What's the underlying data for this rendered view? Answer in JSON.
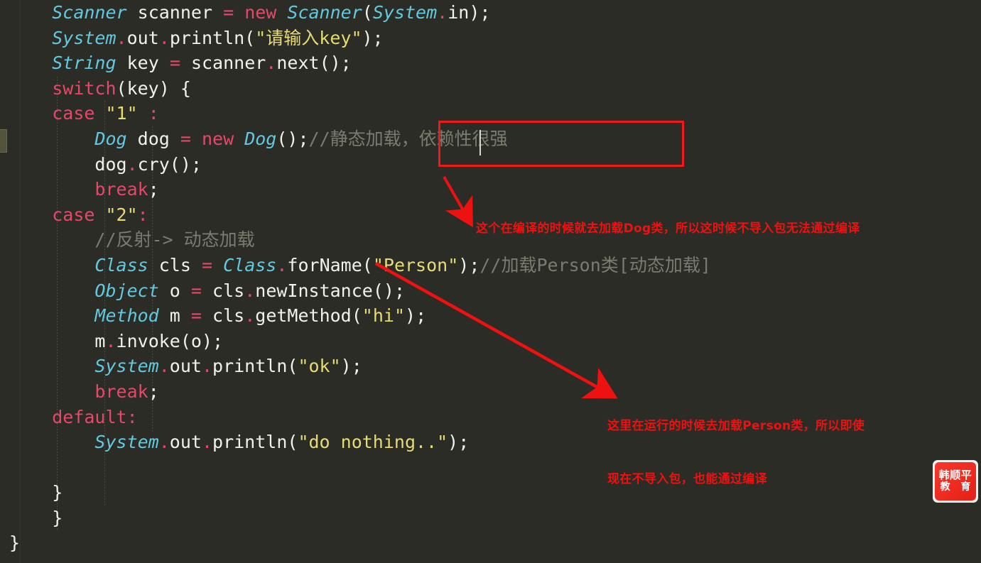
{
  "editor": {
    "background_color": "#2b2c25",
    "lines": [
      {
        "indent": 0,
        "tokens": [
          {
            "t": "Scanner",
            "c": "cls"
          },
          {
            "t": " ",
            "c": "plain"
          },
          {
            "t": "scanner",
            "c": "plain"
          },
          {
            "t": " ",
            "c": "plain"
          },
          {
            "t": "=",
            "c": "kw"
          },
          {
            "t": " ",
            "c": "plain"
          },
          {
            "t": "new",
            "c": "kw"
          },
          {
            "t": " ",
            "c": "plain"
          },
          {
            "t": "Scanner",
            "c": "cls"
          },
          {
            "t": "(",
            "c": "punc"
          },
          {
            "t": "System",
            "c": "cls"
          },
          {
            "t": ".",
            "c": "dot"
          },
          {
            "t": "in",
            "c": "plain"
          },
          {
            "t": ");",
            "c": "punc"
          }
        ]
      },
      {
        "indent": 0,
        "tokens": [
          {
            "t": "System",
            "c": "cls"
          },
          {
            "t": ".",
            "c": "dot"
          },
          {
            "t": "out",
            "c": "plain"
          },
          {
            "t": ".",
            "c": "dot"
          },
          {
            "t": "println",
            "c": "plain"
          },
          {
            "t": "(",
            "c": "punc"
          },
          {
            "t": "\"请输入key\"",
            "c": "str"
          },
          {
            "t": ");",
            "c": "punc"
          }
        ]
      },
      {
        "indent": 0,
        "tokens": [
          {
            "t": "String",
            "c": "cls"
          },
          {
            "t": " ",
            "c": "plain"
          },
          {
            "t": "key",
            "c": "plain"
          },
          {
            "t": " ",
            "c": "plain"
          },
          {
            "t": "=",
            "c": "kw"
          },
          {
            "t": " ",
            "c": "plain"
          },
          {
            "t": "scanner",
            "c": "plain"
          },
          {
            "t": ".",
            "c": "dot"
          },
          {
            "t": "next",
            "c": "plain"
          },
          {
            "t": "();",
            "c": "punc"
          }
        ]
      },
      {
        "indent": 0,
        "tokens": [
          {
            "t": "switch",
            "c": "kw"
          },
          {
            "t": "(key) {",
            "c": "punc"
          }
        ]
      },
      {
        "indent": 1,
        "tokens": [
          {
            "t": "case",
            "c": "kw"
          },
          {
            "t": " ",
            "c": "plain"
          },
          {
            "t": "\"1\"",
            "c": "str"
          },
          {
            "t": " ",
            "c": "plain"
          },
          {
            "t": ":",
            "c": "kw"
          }
        ]
      },
      {
        "indent": 2,
        "tokens": [
          {
            "t": "Dog",
            "c": "cls"
          },
          {
            "t": " ",
            "c": "plain"
          },
          {
            "t": "dog",
            "c": "plain"
          },
          {
            "t": " ",
            "c": "plain"
          },
          {
            "t": "=",
            "c": "kw"
          },
          {
            "t": " ",
            "c": "plain"
          },
          {
            "t": "new",
            "c": "kw"
          },
          {
            "t": " ",
            "c": "plain"
          },
          {
            "t": "Dog",
            "c": "cls"
          },
          {
            "t": "();",
            "c": "punc"
          },
          {
            "t": "//静态加载，依赖性很强",
            "c": "cmt"
          }
        ]
      },
      {
        "indent": 2,
        "tokens": [
          {
            "t": "dog",
            "c": "plain"
          },
          {
            "t": ".",
            "c": "dot"
          },
          {
            "t": "cry",
            "c": "plain"
          },
          {
            "t": "();",
            "c": "punc"
          }
        ]
      },
      {
        "indent": 2,
        "tokens": [
          {
            "t": "break",
            "c": "kw"
          },
          {
            "t": ";",
            "c": "punc"
          }
        ]
      },
      {
        "indent": 1,
        "tokens": [
          {
            "t": "case",
            "c": "kw"
          },
          {
            "t": " ",
            "c": "plain"
          },
          {
            "t": "\"2\"",
            "c": "str"
          },
          {
            "t": ":",
            "c": "kw"
          }
        ]
      },
      {
        "indent": 2,
        "tokens": [
          {
            "t": "//反射-> 动态加载",
            "c": "cmt"
          }
        ]
      },
      {
        "indent": 2,
        "tokens": [
          {
            "t": "Class",
            "c": "cls"
          },
          {
            "t": " ",
            "c": "plain"
          },
          {
            "t": "cls",
            "c": "plain"
          },
          {
            "t": " ",
            "c": "plain"
          },
          {
            "t": "=",
            "c": "kw"
          },
          {
            "t": " ",
            "c": "plain"
          },
          {
            "t": "Class",
            "c": "cls"
          },
          {
            "t": ".",
            "c": "dot"
          },
          {
            "t": "forName",
            "c": "plain"
          },
          {
            "t": "(",
            "c": "punc"
          },
          {
            "t": "\"Person\"",
            "c": "str"
          },
          {
            "t": ");",
            "c": "punc"
          },
          {
            "t": "//加载Person类[动态加载]",
            "c": "cmt"
          }
        ]
      },
      {
        "indent": 2,
        "tokens": [
          {
            "t": "Object",
            "c": "cls"
          },
          {
            "t": " ",
            "c": "plain"
          },
          {
            "t": "o",
            "c": "plain"
          },
          {
            "t": " ",
            "c": "plain"
          },
          {
            "t": "=",
            "c": "kw"
          },
          {
            "t": " ",
            "c": "plain"
          },
          {
            "t": "cls",
            "c": "plain"
          },
          {
            "t": ".",
            "c": "dot"
          },
          {
            "t": "newInstance",
            "c": "plain"
          },
          {
            "t": "();",
            "c": "punc"
          }
        ]
      },
      {
        "indent": 2,
        "tokens": [
          {
            "t": "Method",
            "c": "cls"
          },
          {
            "t": " ",
            "c": "plain"
          },
          {
            "t": "m",
            "c": "plain"
          },
          {
            "t": " ",
            "c": "plain"
          },
          {
            "t": "=",
            "c": "kw"
          },
          {
            "t": " ",
            "c": "plain"
          },
          {
            "t": "cls",
            "c": "plain"
          },
          {
            "t": ".",
            "c": "dot"
          },
          {
            "t": "getMethod",
            "c": "plain"
          },
          {
            "t": "(",
            "c": "punc"
          },
          {
            "t": "\"hi\"",
            "c": "str"
          },
          {
            "t": ");",
            "c": "punc"
          }
        ]
      },
      {
        "indent": 2,
        "tokens": [
          {
            "t": "m",
            "c": "plain"
          },
          {
            "t": ".",
            "c": "dot"
          },
          {
            "t": "invoke",
            "c": "plain"
          },
          {
            "t": "(o);",
            "c": "punc"
          }
        ]
      },
      {
        "indent": 2,
        "tokens": [
          {
            "t": "System",
            "c": "cls"
          },
          {
            "t": ".",
            "c": "dot"
          },
          {
            "t": "out",
            "c": "plain"
          },
          {
            "t": ".",
            "c": "dot"
          },
          {
            "t": "println",
            "c": "plain"
          },
          {
            "t": "(",
            "c": "punc"
          },
          {
            "t": "\"ok\"",
            "c": "str"
          },
          {
            "t": ");",
            "c": "punc"
          }
        ]
      },
      {
        "indent": 2,
        "tokens": [
          {
            "t": "break",
            "c": "kw"
          },
          {
            "t": ";",
            "c": "punc"
          }
        ]
      },
      {
        "indent": 1,
        "tokens": [
          {
            "t": "default",
            "c": "kw"
          },
          {
            "t": ":",
            "c": "kw"
          }
        ]
      },
      {
        "indent": 2,
        "tokens": [
          {
            "t": "System",
            "c": "cls"
          },
          {
            "t": ".",
            "c": "dot"
          },
          {
            "t": "out",
            "c": "plain"
          },
          {
            "t": ".",
            "c": "dot"
          },
          {
            "t": "println",
            "c": "plain"
          },
          {
            "t": "(",
            "c": "punc"
          },
          {
            "t": "\"do nothing..\"",
            "c": "str"
          },
          {
            "t": ");",
            "c": "punc"
          }
        ]
      },
      {
        "indent": 0,
        "tokens": []
      },
      {
        "indent": 1,
        "tokens": [
          {
            "t": "}",
            "c": "punc"
          }
        ]
      },
      {
        "indent": 0,
        "tokens": [
          {
            "t": "}",
            "c": "punc"
          }
        ]
      },
      {
        "indent": -1,
        "tokens": [
          {
            "t": "}",
            "c": "punc"
          }
        ]
      }
    ]
  },
  "annotations": {
    "highlight_box": {
      "color": "#f01818",
      "surrounds_text": "//静态加载，依赖性很强"
    },
    "note_1": {
      "text": "这个在编译的时候就去加载Dog类，所以这时候不导入包无法通过编译",
      "color": "#ee1111"
    },
    "note_2": {
      "line1": "这里在运行的时候去加载Person类，所以即使",
      "line2": "现在不导入包，也能通过编译",
      "color": "#ee1111"
    },
    "arrow_1_label": "arrow-to-note-1",
    "arrow_2_label": "arrow-to-note-2"
  },
  "watermark": {
    "line1": "韩顺平",
    "line2": "教 育",
    "background_color": "#ee2b20"
  }
}
